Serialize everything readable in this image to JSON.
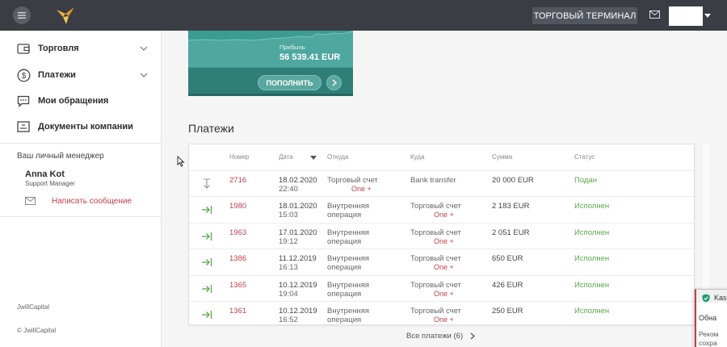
{
  "topbar": {
    "terminal_label": "ТОРГОВЫЙ ТЕРМИНАЛ",
    "icons": [
      "menu-icon",
      "logo-bird",
      "mail-icon",
      "chevron-down-icon"
    ]
  },
  "sidebar": {
    "items": [
      {
        "label": "Торговля",
        "icon": "wallet-icon",
        "expandable": true
      },
      {
        "label": "Платежи",
        "icon": "dollar-circle-icon",
        "expandable": true
      },
      {
        "label": "Мои обращения",
        "icon": "chat-icon",
        "expandable": false
      },
      {
        "label": "Документы компании",
        "icon": "document-icon",
        "expandable": false
      }
    ],
    "manager": {
      "title": "Ваш личный менеджер",
      "name": "Anna Kot",
      "role": "Support Manager",
      "write_label": "Написать сообщение"
    },
    "brand": "JwillCapital",
    "copyright": "© JwillCapital"
  },
  "account_card": {
    "profit_label": "Прибыль",
    "profit_value": "56 539.41 EUR",
    "topup_label": "ПОПОЛНИТЬ"
  },
  "payments": {
    "title": "Платежи",
    "columns": {
      "number": "Номер",
      "date": "Дата",
      "from": "Откуда",
      "to": "Куда",
      "amount": "Сумма",
      "status": "Статус"
    },
    "rows": [
      {
        "type": "withdrawal",
        "number": "2716",
        "date": "18.02.2020",
        "time": "22:40",
        "from": "Торговый счет",
        "from_sub": "One +",
        "to": "Bank transfer",
        "to_sub": "",
        "amount": "20 000 EUR",
        "status": "Подан"
      },
      {
        "type": "deposit",
        "number": "1980",
        "date": "18.01.2020",
        "time": "15:03",
        "from": "Внутренняя",
        "from_sub": "операция",
        "to": "Торговый счет",
        "to_sub": "One +",
        "amount": "2 183 EUR",
        "status": "Исполнен"
      },
      {
        "type": "deposit",
        "number": "1963",
        "date": "17.01.2020",
        "time": "19:12",
        "from": "Внутренняя",
        "from_sub": "операция",
        "to": "Торговый счет",
        "to_sub": "One +",
        "amount": "2 051 EUR",
        "status": "Исполнен"
      },
      {
        "type": "deposit",
        "number": "1386",
        "date": "11.12.2019",
        "time": "16:13",
        "from": "Внутренняя",
        "from_sub": "операция",
        "to": "Торговый счет",
        "to_sub": "One +",
        "amount": "650 EUR",
        "status": "Исполнен"
      },
      {
        "type": "deposit",
        "number": "1365",
        "date": "10.12.2019",
        "time": "19:04",
        "from": "Внутренняя",
        "from_sub": "операция",
        "to": "Торговый счет",
        "to_sub": "One +",
        "amount": "426 EUR",
        "status": "Исполнен"
      },
      {
        "type": "deposit",
        "number": "1361",
        "date": "10.12.2019",
        "time": "16:52",
        "from": "Внутренняя",
        "from_sub": "операция",
        "to": "Торговый счет",
        "to_sub": "One +",
        "amount": "250 EUR",
        "status": "Исполнен"
      }
    ],
    "all_label": "Все платежи (6)"
  },
  "popup": {
    "title": "Kasp",
    "line1": "Обна",
    "line2a": "Реком",
    "line2b": "сохра"
  },
  "colors": {
    "topbar": "#3a3d44",
    "accent_red": "#c0414b",
    "teal": "#3d9c94",
    "status_green": "#5aa84a"
  }
}
